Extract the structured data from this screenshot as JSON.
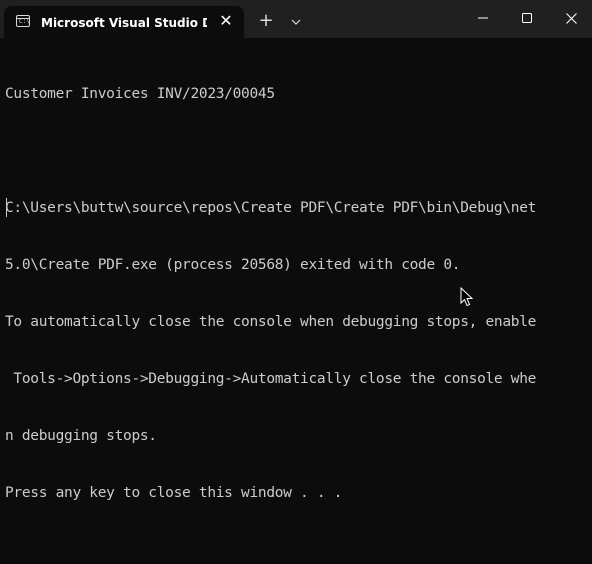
{
  "window": {
    "tab_title": "Microsoft Visual Studio Debug Console",
    "tab_icon_glyph": "C:\\",
    "new_tab_symbol": "+",
    "close_tab_symbol": "✕"
  },
  "colors": {
    "background": "#0c0c0c",
    "titlebar": "#202020",
    "text": "#cccccc"
  },
  "console": {
    "lines": [
      "Customer Invoices INV/2023/00045",
      "",
      "C:\\Users\\buttw\\source\\repos\\Create PDF\\Create PDF\\bin\\Debug\\net",
      "5.0\\Create PDF.exe (process 20568) exited with code 0.",
      "To automatically close the console when debugging stops, enable",
      " Tools->Options->Debugging->Automatically close the console whe",
      "n debugging stops.",
      "Press any key to close this window . . ."
    ]
  }
}
